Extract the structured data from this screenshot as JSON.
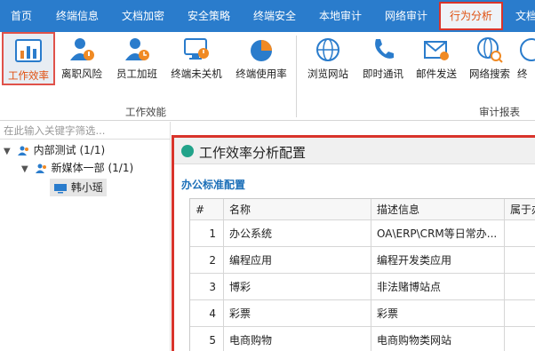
{
  "menu": {
    "items": [
      "首页",
      "终端信息",
      "文档加密",
      "安全策略",
      "终端安全",
      "本地审计",
      "网络审计",
      "行为分析",
      "文档"
    ],
    "active_index": 7
  },
  "ribbon": {
    "buttons": [
      {
        "label": "工作效率",
        "icon": "bar-chart-icon",
        "selected": true
      },
      {
        "label": "离职风险",
        "icon": "user-warning-icon"
      },
      {
        "label": "员工加班",
        "icon": "user-clock-icon"
      },
      {
        "label": "终端未关机",
        "icon": "monitor-power-icon"
      },
      {
        "label": "终端使用率",
        "icon": "pie-chart-icon"
      },
      {
        "label": "浏览网站",
        "icon": "globe-icon"
      },
      {
        "label": "即时通讯",
        "icon": "phone-icon"
      },
      {
        "label": "邮件发送",
        "icon": "mail-send-icon"
      },
      {
        "label": "网络搜索",
        "icon": "globe-search-icon"
      },
      {
        "label": "终",
        "icon": "terminal-icon"
      }
    ],
    "groups": [
      "工作效能",
      "审计报表"
    ]
  },
  "left_panel": {
    "search_placeholder": "在此输入关键字筛选...",
    "tree": [
      {
        "label": "内部测试 (1/1)",
        "level": 0
      },
      {
        "label": "新媒体一部 (1/1)",
        "level": 1
      },
      {
        "label": "韩小瑶",
        "level": 2,
        "selected": true
      }
    ]
  },
  "dialog": {
    "title": "工作效率分析配置",
    "section": "办公标准配置",
    "columns": [
      "#",
      "名称",
      "描述信息",
      "属于办"
    ],
    "rows": [
      {
        "num": "1",
        "name": "办公系统",
        "desc": "OA\\ERP\\CRM等日常办..."
      },
      {
        "num": "2",
        "name": "编程应用",
        "desc": "编程开发类应用"
      },
      {
        "num": "3",
        "name": "博彩",
        "desc": "非法赌博站点"
      },
      {
        "num": "4",
        "name": "彩票",
        "desc": "彩票"
      },
      {
        "num": "5",
        "name": "电商购物",
        "desc": "电商购物类网站"
      }
    ]
  },
  "colors": {
    "menubar": "#2a7ccc",
    "highlight": "#d9342b",
    "section": "#1c6fb8"
  }
}
